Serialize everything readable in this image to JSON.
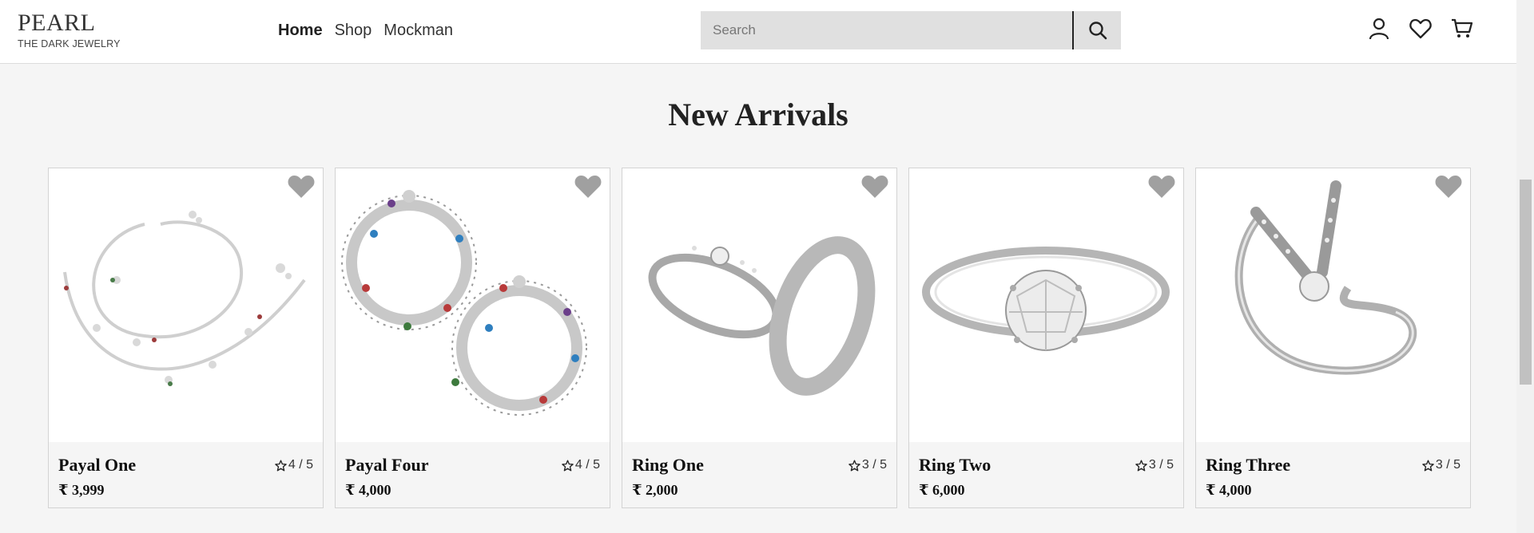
{
  "brand": {
    "name": "PEARL",
    "tagline": "THE DARK JEWELRY"
  },
  "nav": {
    "items": [
      "Home",
      "Shop",
      "Mockman"
    ],
    "active": "Home"
  },
  "search": {
    "placeholder": "Search",
    "icon": "search-icon"
  },
  "header_icons": [
    "user-icon",
    "heart-icon",
    "cart-icon"
  ],
  "section": {
    "title": "New Arrivals"
  },
  "products": [
    {
      "name": "Payal One",
      "rating": "4 / 5",
      "price": "₹ 3,999",
      "image": "anklet-pair"
    },
    {
      "name": "Payal Four",
      "rating": "4 / 5",
      "price": "₹ 4,000",
      "image": "beaded-anklet-pair"
    },
    {
      "name": "Ring One",
      "rating": "3 / 5",
      "price": "₹ 2,000",
      "image": "couple-rings"
    },
    {
      "name": "Ring Two",
      "rating": "3 / 5",
      "price": "₹ 6,000",
      "image": "solitaire-ring"
    },
    {
      "name": "Ring Three",
      "rating": "3 / 5",
      "price": "₹ 4,000",
      "image": "letter-v-ring"
    }
  ],
  "colors": {
    "accent": "#222222",
    "favorite_icon": "#a0a0a0",
    "search_bg": "#e0e0e0",
    "page_bg": "#f5f5f5"
  }
}
